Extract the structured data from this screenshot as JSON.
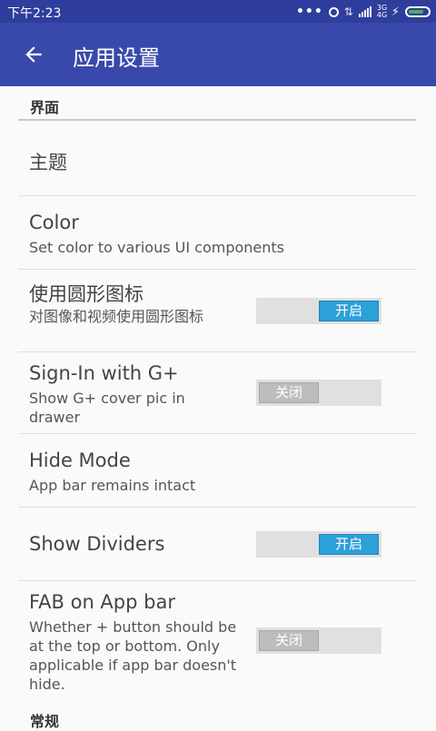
{
  "status": {
    "time": "下午2:23",
    "dots": "•••",
    "net_label": "3G 4G"
  },
  "app_bar": {
    "title": "应用设置"
  },
  "sections": {
    "interface": "界面",
    "general": "常规"
  },
  "prefs": {
    "theme": {
      "title": "主题"
    },
    "color": {
      "title": "Color",
      "summary": "Set color to various UI components"
    },
    "round_icons": {
      "title": "使用圆形图标",
      "summary": "对图像和视频使用圆形图标",
      "toggle": "开启",
      "on": true
    },
    "signin": {
      "title": "Sign-In with G+",
      "summary": "Show G+ cover pic in drawer",
      "toggle": "关闭",
      "on": false
    },
    "hide_mode": {
      "title": "Hide Mode",
      "summary": "App bar remains intact"
    },
    "dividers": {
      "title": "Show Dividers",
      "toggle": "开启",
      "on": true
    },
    "fab": {
      "title": "FAB on App bar",
      "summary": "Whether + button should be at the top or bottom. Only applicable if app bar doesn't hide.",
      "toggle": "关闭",
      "on": false
    }
  },
  "colors": {
    "status_bar": "#2f3d9c",
    "app_bar": "#3949ab",
    "toggle_on": "#2ca0d8",
    "toggle_off": "#bdbdbd"
  }
}
